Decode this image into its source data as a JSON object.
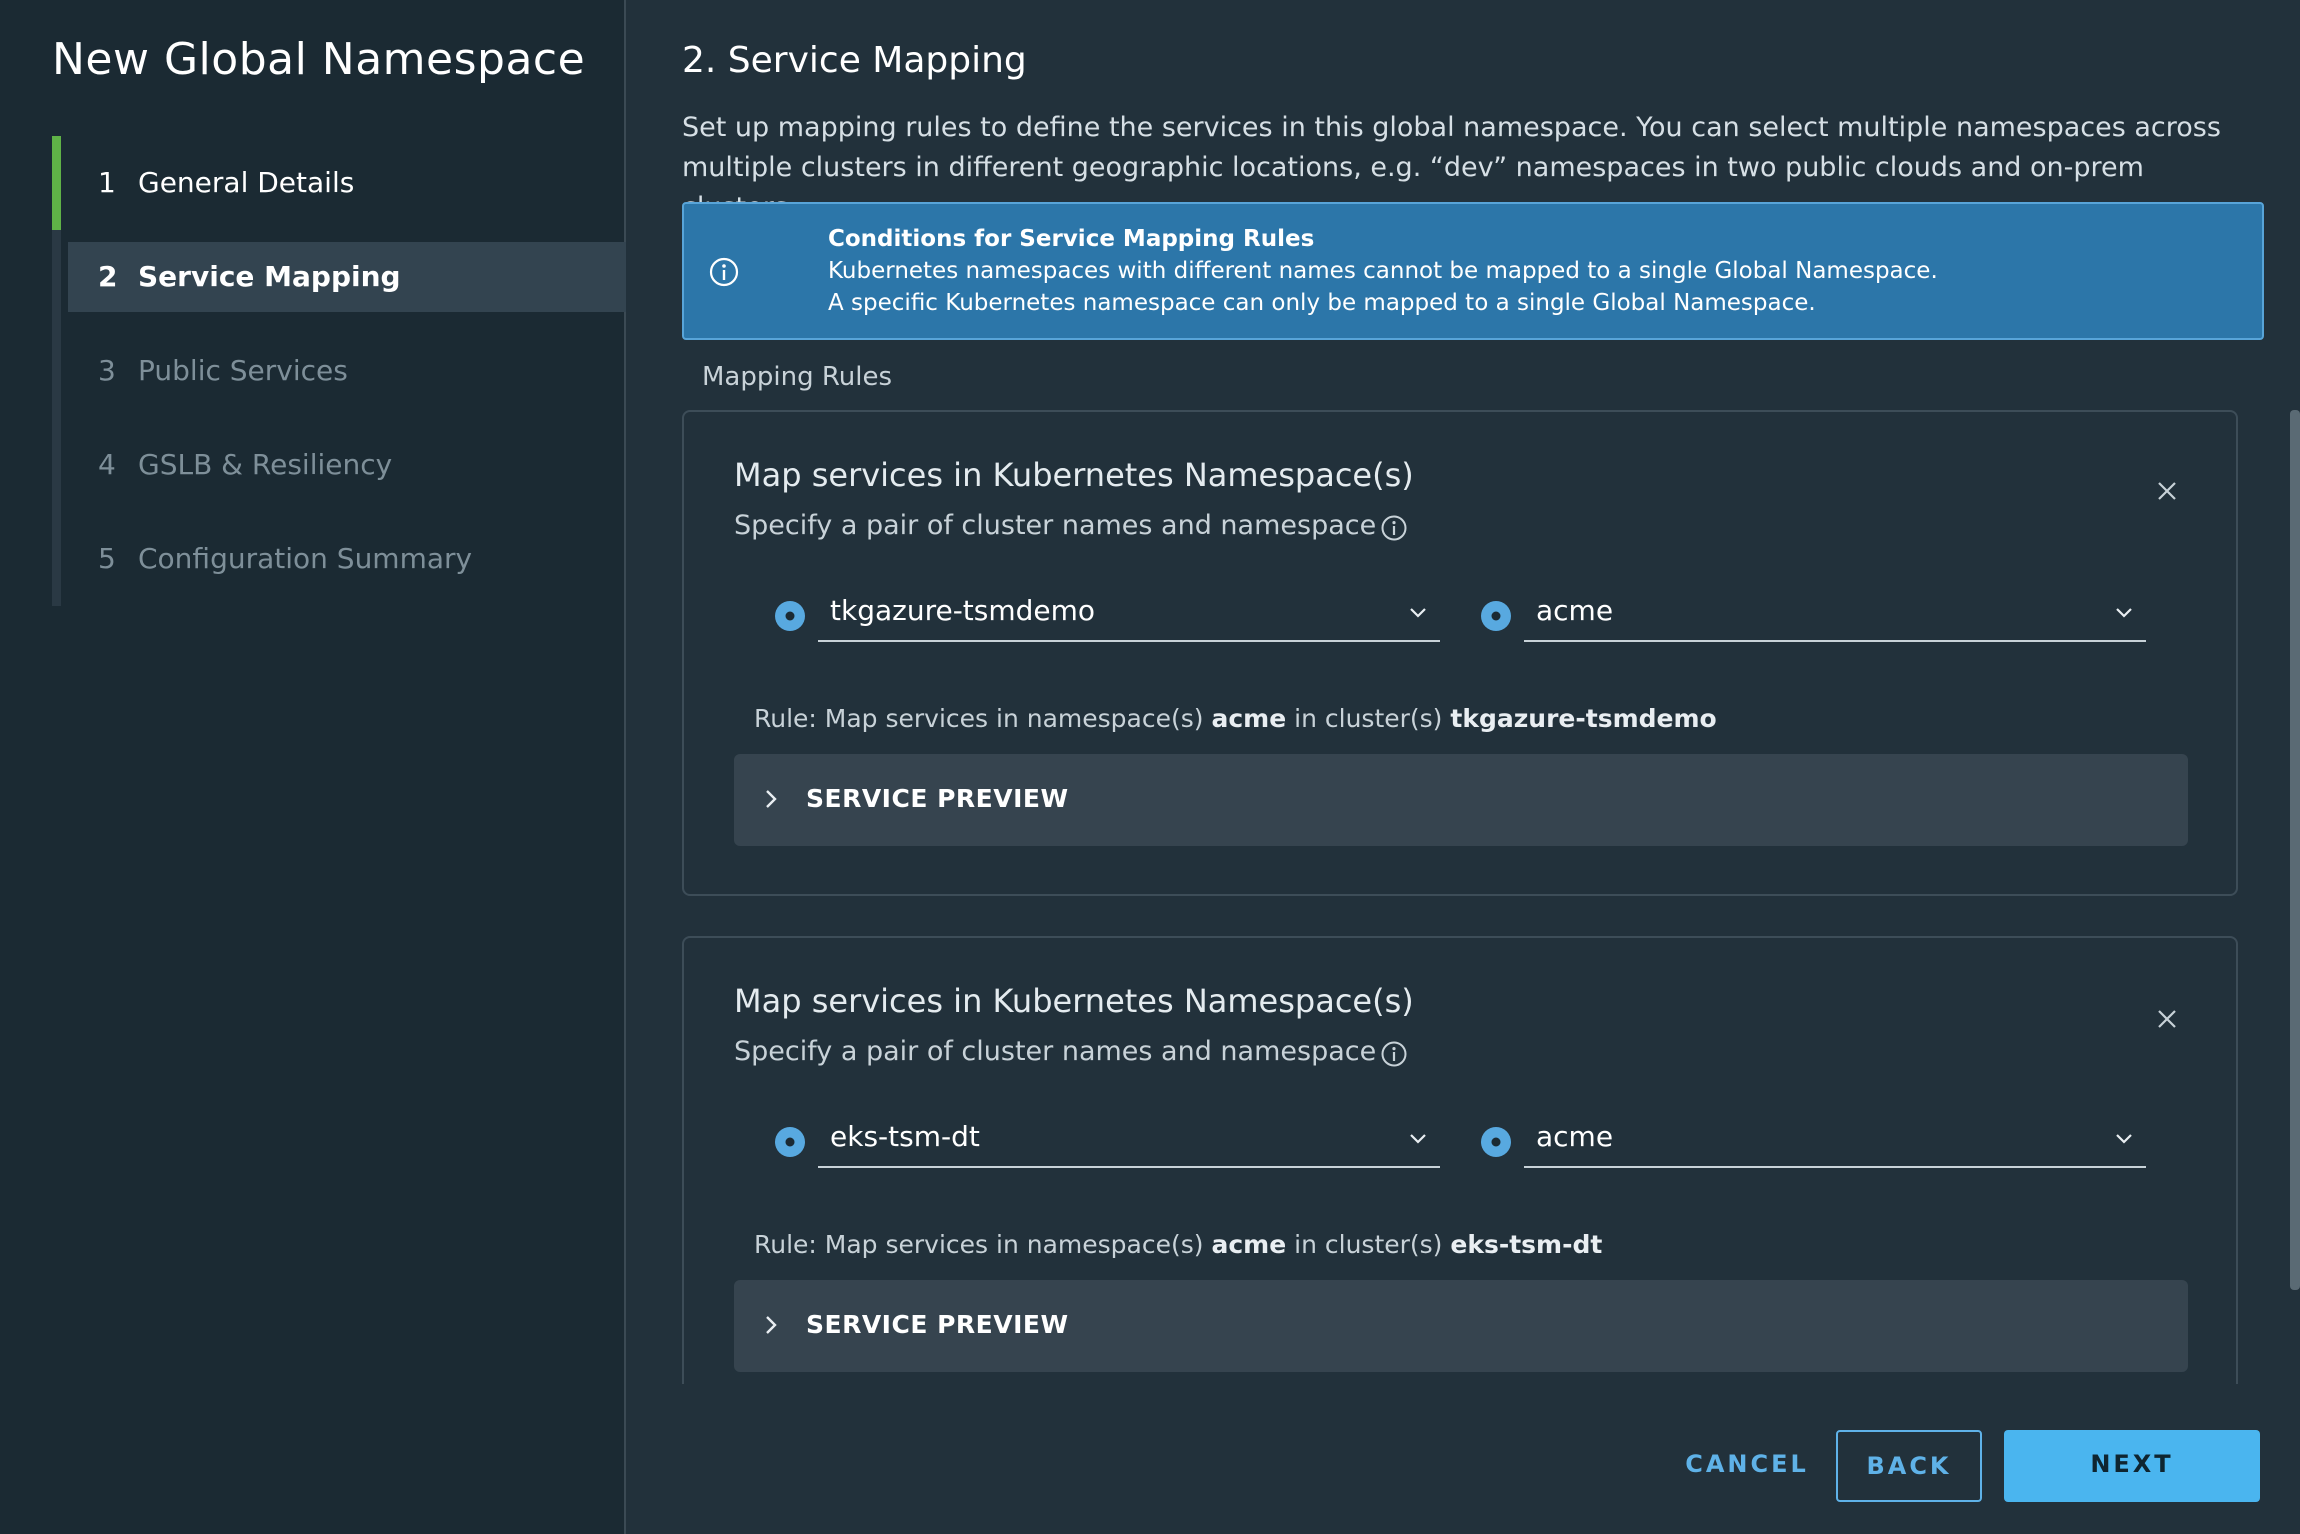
{
  "sidebar": {
    "title": "New Global Namespace",
    "steps": [
      {
        "num": "1",
        "label": "General Details"
      },
      {
        "num": "2",
        "label": "Service Mapping"
      },
      {
        "num": "3",
        "label": "Public Services"
      },
      {
        "num": "4",
        "label": "GSLB & Resiliency"
      },
      {
        "num": "5",
        "label": "Configuration Summary"
      }
    ]
  },
  "main": {
    "heading": "2. Service Mapping",
    "intro": "Set up mapping rules to define the services in this global namespace. You can select multiple namespaces across multiple clusters in different geographic locations, e.g. “dev” namespaces in two public clouds and on-prem clusters.",
    "alert": {
      "title": "Conditions for Service Mapping Rules",
      "line1": "Kubernetes namespaces with different names cannot be mapped to a single Global Namespace.",
      "line2": "A specific Kubernetes namespace can only be mapped to a single Global Namespace."
    },
    "section_label": "Mapping Rules",
    "rules": [
      {
        "title": "Map services in Kubernetes Namespace(s)",
        "subtitle": "Specify a pair of cluster names and namespace",
        "cluster": "tkgazure-tsmdemo",
        "namespace": "acme",
        "rule_prefix": "Rule: Map services in namespace(s)",
        "rule_mid": "in cluster(s)",
        "preview_label": "SERVICE PREVIEW"
      },
      {
        "title": "Map services in Kubernetes Namespace(s)",
        "subtitle": "Specify a pair of cluster names and namespace",
        "cluster": "eks-tsm-dt",
        "namespace": "acme",
        "rule_prefix": "Rule: Map services in namespace(s)",
        "rule_mid": "in cluster(s)",
        "preview_label": "SERVICE PREVIEW"
      }
    ]
  },
  "footer": {
    "cancel": "CANCEL",
    "back": "BACK",
    "next": "NEXT"
  },
  "colors": {
    "accent": "#4ab5ef",
    "step_active": "#5fb247",
    "alert_bg": "#2c76a9"
  }
}
